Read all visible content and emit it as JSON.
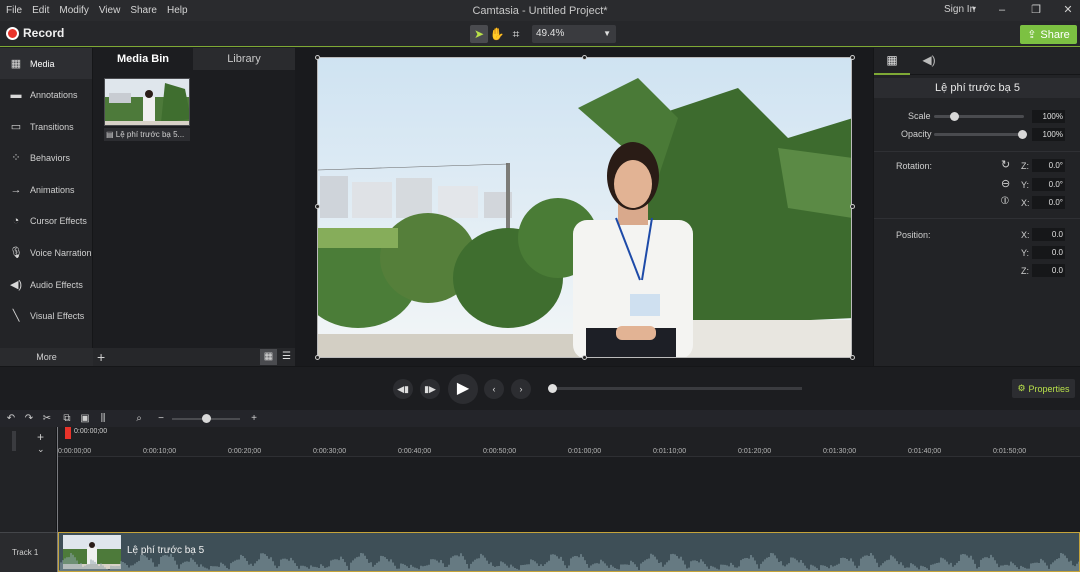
{
  "window": {
    "title": "Camtasia - Untitled Project*",
    "sign_in": "Sign In",
    "menus": [
      "File",
      "Edit",
      "Modify",
      "View",
      "Share",
      "Help"
    ]
  },
  "toolbar": {
    "record_label": "Record",
    "zoom_value": "49.4%",
    "share_label": "Share"
  },
  "sidebar": {
    "items": [
      {
        "label": "Media",
        "icon": "film-icon"
      },
      {
        "label": "Annotations",
        "icon": "annotation-icon"
      },
      {
        "label": "Transitions",
        "icon": "transition-icon"
      },
      {
        "label": "Behaviors",
        "icon": "behavior-icon"
      },
      {
        "label": "Animations",
        "icon": "animation-icon"
      },
      {
        "label": "Cursor Effects",
        "icon": "cursor-icon"
      },
      {
        "label": "Voice Narration",
        "icon": "microphone-icon"
      },
      {
        "label": "Audio Effects",
        "icon": "speaker-icon"
      },
      {
        "label": "Visual Effects",
        "icon": "wand-icon"
      }
    ],
    "more_label": "More"
  },
  "media_bin": {
    "tabs": [
      "Media Bin",
      "Library"
    ],
    "clip_label": "Lệ phí trước bạ 5..."
  },
  "properties": {
    "clip_name": "Lệ phí trước bạ 5",
    "scale_label": "Scale",
    "scale_value": "100%",
    "opacity_label": "Opacity",
    "opacity_value": "100%",
    "rotation_label": "Rotation:",
    "rotation": {
      "z": "0.0°",
      "y": "0.0°",
      "x": "0.0°"
    },
    "position_label": "Position:",
    "position": {
      "x": "0.0",
      "y": "0.0",
      "z": "0.0"
    },
    "axis_labels": {
      "z": "Z:",
      "y": "Y:",
      "x": "X:"
    }
  },
  "playback": {
    "properties_label": "Properties"
  },
  "timeline": {
    "playhead_time": "0:00:00;00",
    "ticks": [
      "0:00:00;00",
      "0:00:10;00",
      "0:00:20;00",
      "0:00:30;00",
      "0:00:40;00",
      "0:00:50;00",
      "0:01:00;00",
      "0:01:10;00",
      "0:01:20;00",
      "0:01:30;00",
      "0:01:40;00",
      "0:01:50;00",
      "0:02:00;00"
    ],
    "track_label": "Track 1",
    "clip_label": "Lệ phí trước bạ 5"
  },
  "colors": {
    "accent": "#7cc142",
    "record": "#e8332a",
    "clip_border": "#c5a43b"
  }
}
